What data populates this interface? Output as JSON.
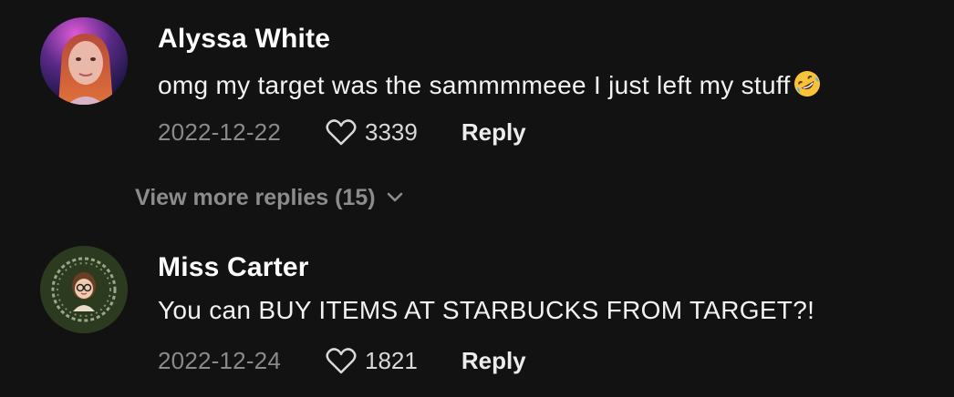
{
  "comments": [
    {
      "author": "Alyssa White",
      "text": "omg my target was the sammmmeee I just left my stuff",
      "emoji": "rolling-on-floor-laughing-emoji",
      "date": "2022-12-22",
      "likes": "3339",
      "reply_label": "Reply"
    },
    {
      "author": "Miss Carter",
      "text": "You can BUY ITEMS AT STARBUCKS FROM TARGET?!",
      "date": "2022-12-24",
      "likes": "1821",
      "reply_label": "Reply"
    }
  ],
  "view_more": {
    "label": "View more replies (15)",
    "icon": "chevron-down-icon"
  },
  "icons": {
    "like": "heart-outline-icon"
  },
  "colors": {
    "background": "#121212",
    "author": "#ffffff",
    "muted": "#8a8a8a"
  }
}
